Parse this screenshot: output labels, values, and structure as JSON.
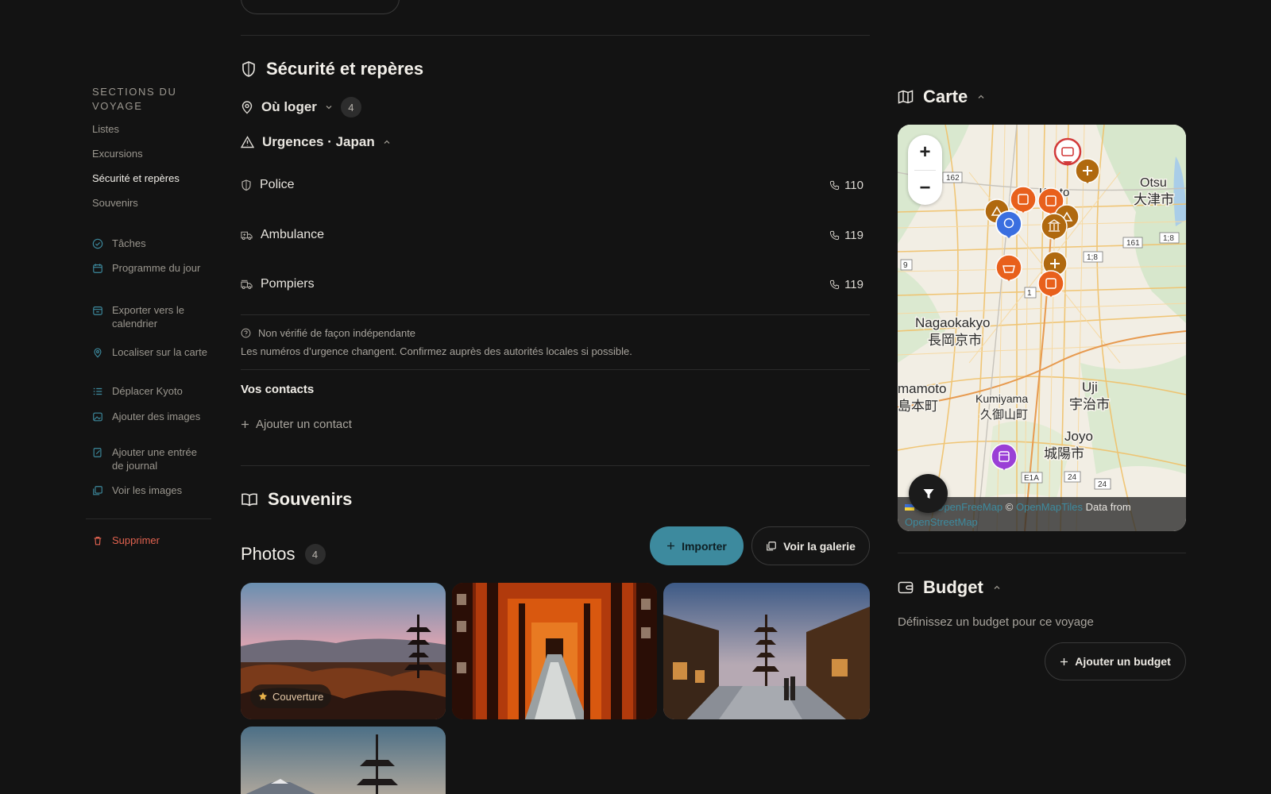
{
  "sidebar": {
    "title": "SECTIONS DU VOYAGE",
    "links": [
      "Listes",
      "Excursions",
      "Sécurité et repères",
      "Souvenirs"
    ],
    "actions": [
      {
        "label": "Tâches",
        "icon": "check-circle-icon"
      },
      {
        "label": "Programme du jour",
        "icon": "calendar-icon"
      },
      {
        "label": "Exporter vers le calendrier",
        "icon": "calendar-export-icon"
      },
      {
        "label": "Localiser sur la carte",
        "icon": "map-pin-icon"
      },
      {
        "label": "Déplacer Kyoto",
        "icon": "reorder-icon"
      },
      {
        "label": "Ajouter des images",
        "icon": "image-add-icon"
      },
      {
        "label": "Ajouter une entrée de journal",
        "icon": "journal-edit-icon"
      },
      {
        "label": "Voir les images",
        "icon": "images-icon"
      }
    ],
    "delete_label": "Supprimer"
  },
  "safety": {
    "title": "Sécurité et repères",
    "where_to_stay": {
      "label": "Où loger",
      "count": "4"
    },
    "emergency": {
      "label": "Urgences · Japan",
      "rows": [
        {
          "label": "Police",
          "number": "110",
          "icon": "shield-icon"
        },
        {
          "label": "Ambulance",
          "number": "119",
          "icon": "ambulance-icon"
        },
        {
          "label": "Pompiers",
          "number": "119",
          "icon": "fire-truck-icon"
        }
      ],
      "disclaimer_title": "Non vérifié de façon indépendante",
      "disclaimer_text": "Les numéros d’urgence changent. Confirmez auprès des autorités locales si possible."
    },
    "contacts": {
      "title": "Vos contacts",
      "add_label": "Ajouter un contact"
    }
  },
  "souvenirs": {
    "title": "Souvenirs",
    "photos_label": "Photos",
    "photos_count": "4",
    "import_label": "Importer",
    "gallery_label": "Voir la galerie",
    "cover_label": "Couverture"
  },
  "map_panel": {
    "title": "Carte",
    "zoom_in": "+",
    "zoom_out": "−",
    "labels": {
      "kyoto": "Kyoto",
      "otsu_en": "Otsu",
      "otsu_jp": "大津市",
      "nagaokakyo_en": "Nagaokakyo",
      "nagaokakyo_jp": "長岡京市",
      "shimamoto_en": "mamoto",
      "shimamoto_jp": "島本町",
      "kumiyama_en": "Kumiyama",
      "kumiyama_jp": "久御山町",
      "uji_en": "Uji",
      "uji_jp": "宇治市",
      "joyo_en": "Joyo",
      "joyo_jp": "城陽市",
      "r162": "162",
      "r161": "161",
      "r18a": "1;8",
      "r18b": "1;8",
      "r9": "9",
      "r1": "1",
      "r24a": "24",
      "r24b": "24",
      "e1a": "E1A"
    },
    "attribution": {
      "leaflet": "let",
      "sep": " | ",
      "ofm": "OpenFreeMap",
      "copy": " © ",
      "omt": "OpenMapTiles",
      "data": " Data from ",
      "osm": "OpenStreetMap"
    }
  },
  "budget": {
    "title": "Budget",
    "description": "Définissez un budget pour ce voyage",
    "add_label": "Ajouter un budget"
  },
  "colors": {
    "accent": "#3d8a9e",
    "danger": "#e0624f",
    "marker_orange": "#e8601c",
    "marker_brown": "#b0690f",
    "marker_blue": "#3a6fe0",
    "marker_purple": "#9a3fd6",
    "marker_red": "#d23a3a"
  }
}
